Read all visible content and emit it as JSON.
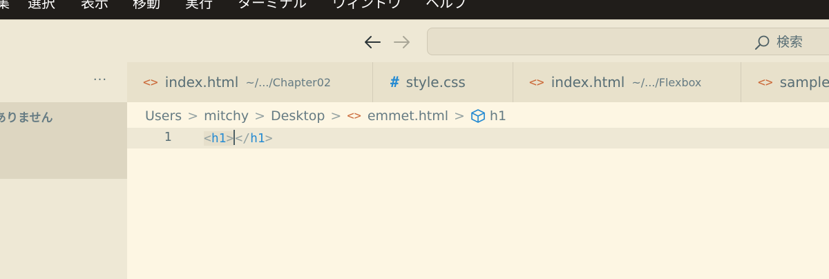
{
  "menubar": {
    "items": [
      "集",
      "選択",
      "表示",
      "移動",
      "実行",
      "ターミナル",
      "ウィンドウ",
      "ヘルプ"
    ]
  },
  "titlebar": {
    "search_label": "検索",
    "back_icon": "arrow-left-icon",
    "forward_icon": "arrow-right-icon"
  },
  "sidebar": {
    "more_label": "···",
    "empty_message": "ありません"
  },
  "tabs": [
    {
      "icon": "<>",
      "name": "index.html",
      "path": "~/.../Chapter02"
    },
    {
      "icon": "#",
      "name": "style.css",
      "path": ""
    },
    {
      "icon": "<>",
      "name": "index.html",
      "path": "~/.../Flexbox"
    },
    {
      "icon": "<>",
      "name": "sample",
      "path": ""
    }
  ],
  "breadcrumb": {
    "users": "Users",
    "user": "mitchy",
    "folder": "Desktop",
    "file": "emmet.html",
    "symbol": "h1",
    "sep": ">",
    "file_icon": "<>",
    "symbol_icon": "cube-icon"
  },
  "editor": {
    "line_number": "1",
    "code": {
      "open_lt": "<",
      "open_tag": "h1",
      "open_gt": ">",
      "close_lt": "</",
      "close_tag": "h1",
      "close_gt": ">"
    }
  },
  "colors": {
    "background": "#fdf6e3",
    "sidebar": "#eee8d5",
    "tag_blue": "#268bd2",
    "icon_orange": "#cb6a3a",
    "menubar": "#201d1a"
  }
}
